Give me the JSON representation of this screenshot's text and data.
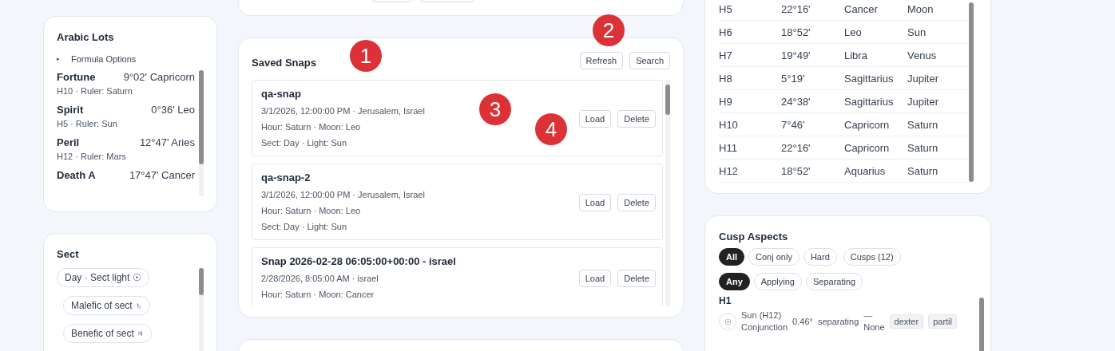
{
  "arabic_lots": {
    "title": "Arabic Lots",
    "disclosure": {
      "icon": "▸",
      "label": "Formula Options",
      "expanded": false
    },
    "lots": [
      {
        "name": "Fortune",
        "position": "9°02' Capricorn",
        "detail": "H10 · Ruler: Saturn"
      },
      {
        "name": "Spirit",
        "position": "0°36' Leo",
        "detail": "H5 · Ruler: Sun"
      },
      {
        "name": "Peril",
        "position": "12°47' Aries",
        "detail": "H12 · Ruler: Mars"
      },
      {
        "name": "Death A",
        "position": "17°47' Cancer"
      }
    ]
  },
  "sect": {
    "title": "Sect",
    "chips": [
      {
        "label": "Day · Sect light ☉",
        "children": [
          {
            "label": "Malefic of sect ♄"
          },
          {
            "label": "Benefic of sect ♃"
          }
        ]
      }
    ]
  },
  "saved_snaps": {
    "title": "Saved Snaps",
    "actions": [
      "Refresh",
      "Search"
    ],
    "snaps": [
      {
        "name": "qa-snap",
        "lines": [
          "3/1/2026, 12:00:00 PM · Jerusalem, Israel",
          "Hour: Saturn · Moon: Leo",
          "Sect: Day · Light: Sun"
        ],
        "buttons": [
          "Load",
          "Delete"
        ]
      },
      {
        "name": "qa-snap-2",
        "lines": [
          "3/1/2026, 12:00:00 PM · Jerusalem, Israel",
          "Hour: Saturn · Moon: Leo",
          "Sect: Day · Light: Sun"
        ],
        "buttons": [
          "Load",
          "Delete"
        ]
      },
      {
        "name": "Snap 2026-02-28 06:05:00+00:00 - israel",
        "lines": [
          "2/28/2026, 8:05:00 AM · israel",
          "Hour: Saturn · Moon: Cancer"
        ],
        "buttons": [
          "Load",
          "Delete"
        ]
      }
    ]
  },
  "houses": {
    "rows": [
      {
        "cells": [
          "H5",
          "22°16'",
          "Cancer",
          "Moon"
        ]
      },
      {
        "cells": [
          "H6",
          "18°52'",
          "Leo",
          "Sun"
        ]
      },
      {
        "cells": [
          "H7",
          "19°49'",
          "Libra",
          "Venus"
        ]
      },
      {
        "cells": [
          "H8",
          "5°19'",
          "Sagittarius",
          "Jupiter"
        ]
      },
      {
        "cells": [
          "H9",
          "24°38'",
          "Sagittarius",
          "Jupiter"
        ]
      },
      {
        "cells": [
          "H10",
          "7°46'",
          "Capricorn",
          "Saturn"
        ]
      },
      {
        "cells": [
          "H11",
          "22°16'",
          "Capricorn",
          "Saturn"
        ]
      },
      {
        "cells": [
          "H12",
          "18°52'",
          "Aquarius",
          "Saturn"
        ]
      }
    ]
  },
  "cusp_aspects": {
    "title": "Cusp Aspects",
    "filter_rows": [
      [
        {
          "label": "All",
          "selected": true
        },
        {
          "label": "Conj only",
          "selected": false
        },
        {
          "label": "Hard",
          "selected": false
        },
        {
          "label": "Cusps (12)",
          "selected": false
        }
      ],
      [
        {
          "label": "Any",
          "selected": true
        },
        {
          "label": "Applying",
          "selected": false
        },
        {
          "label": "Separating",
          "selected": false
        }
      ]
    ],
    "groups": [
      {
        "house": "H1",
        "aspects": [
          {
            "icon": "☉",
            "body": "Sun (H12)",
            "aspect": "Conjunction",
            "orb": "0.46°",
            "motion": "separating",
            "reception": [
              "—",
              "None"
            ],
            "tags": [
              "dexter",
              "partil"
            ]
          }
        ]
      }
    ]
  },
  "annotations": [
    {
      "label": "1"
    },
    {
      "label": "2"
    },
    {
      "label": "3"
    },
    {
      "label": "4"
    }
  ]
}
